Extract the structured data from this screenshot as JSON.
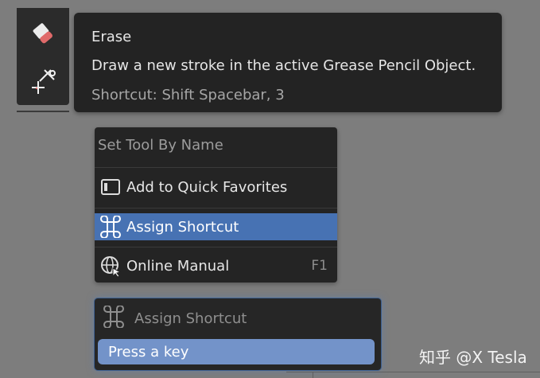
{
  "toolbar": {
    "tools": [
      {
        "icon": "eraser-icon",
        "selected": false
      },
      {
        "icon": "scissors-cursor-icon",
        "selected": false
      }
    ]
  },
  "tooltip": {
    "title": "Erase",
    "description": "Draw a new stroke in the active Grease Pencil Object.",
    "shortcut": "Shortcut: Shift Spacebar, 3"
  },
  "context_menu": {
    "header": "Set Tool By Name",
    "items": [
      {
        "label": "Add to Quick Favorites",
        "icon": "quick-favorites-icon",
        "shortcut": "",
        "active": false
      },
      {
        "label": "Assign Shortcut",
        "icon": "command-key-icon",
        "shortcut": "",
        "active": true
      },
      {
        "label": "Online Manual",
        "icon": "globe-icon",
        "shortcut": "F1",
        "active": false
      }
    ]
  },
  "assign_popup": {
    "title": "Assign Shortcut",
    "prompt": "Press a key"
  },
  "watermark": "知乎 @X Tesla",
  "colors": {
    "background": "#7d7d7d",
    "panel": "#242424",
    "highlight": "#4772b3",
    "input_highlight": "#7393c9"
  }
}
